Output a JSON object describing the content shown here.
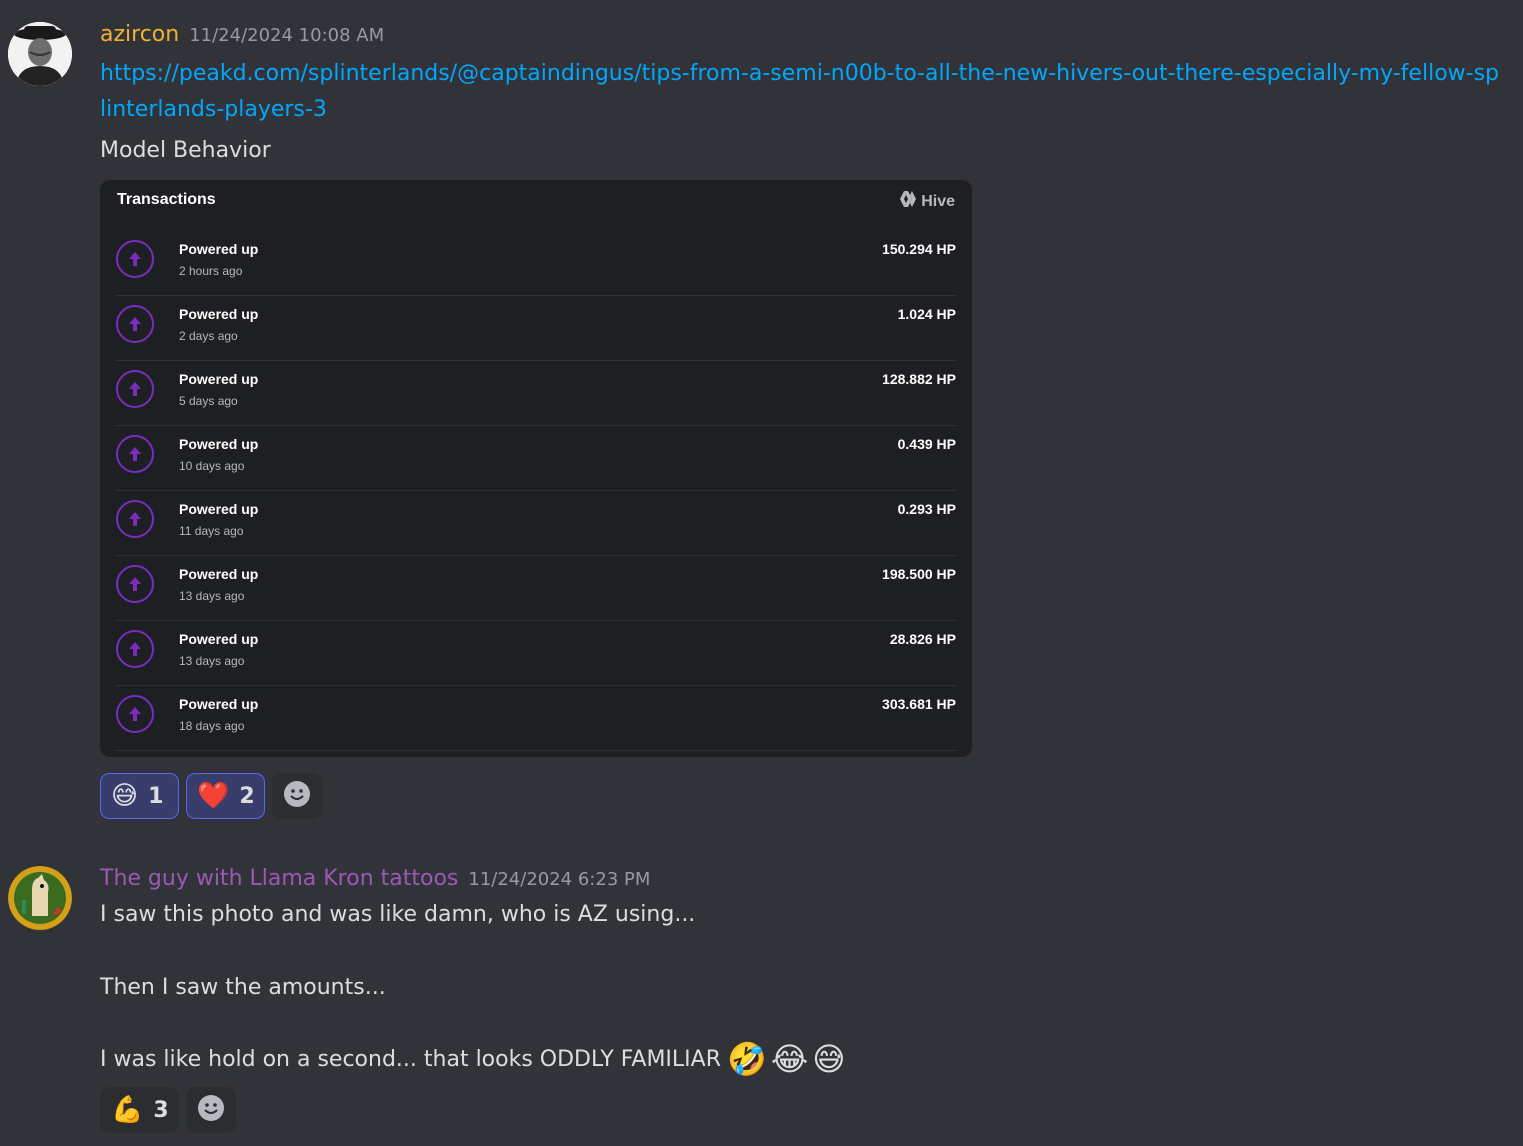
{
  "messages": [
    {
      "username": "azircon",
      "username_color": "#f0b232",
      "timestamp": "11/24/2024 10:08 AM",
      "link": "https://peakd.com/splinterlands/@captaindingus/tips-from-a-semi-n00b-to-all-the-new-hivers-out-there-especially-my-fellow-splinterlands-players-3",
      "text": "Model Behavior",
      "embed": {
        "title": "Transactions",
        "brand": "Hive",
        "transactions": [
          {
            "label": "Powered up",
            "time": "2 hours ago",
            "amount": "150.294 HP"
          },
          {
            "label": "Powered up",
            "time": "2 days ago",
            "amount": "1.024 HP"
          },
          {
            "label": "Powered up",
            "time": "5 days ago",
            "amount": "128.882 HP"
          },
          {
            "label": "Powered up",
            "time": "10 days ago",
            "amount": "0.439 HP"
          },
          {
            "label": "Powered up",
            "time": "11 days ago",
            "amount": "0.293 HP"
          },
          {
            "label": "Powered up",
            "time": "13 days ago",
            "amount": "198.500 HP"
          },
          {
            "label": "Powered up",
            "time": "13 days ago",
            "amount": "28.826 HP"
          },
          {
            "label": "Powered up",
            "time": "18 days ago",
            "amount": "303.681 HP"
          }
        ]
      },
      "reactions": [
        {
          "emoji": "😅",
          "count": "1"
        },
        {
          "emoji": "❤️",
          "count": "2"
        }
      ]
    },
    {
      "username": "The guy with Llama Kron tattoos",
      "username_color": "#9b59b6",
      "timestamp": "11/24/2024 6:23 PM",
      "lines": [
        "I saw this photo and was like damn, who is AZ using...",
        "Then I saw the amounts...",
        "I was like hold on a second... that looks ODDLY FAMILIAR"
      ],
      "line_emojis": "🤣😂😅",
      "reactions": [
        {
          "emoji": "💪",
          "count": "3"
        }
      ]
    }
  ]
}
